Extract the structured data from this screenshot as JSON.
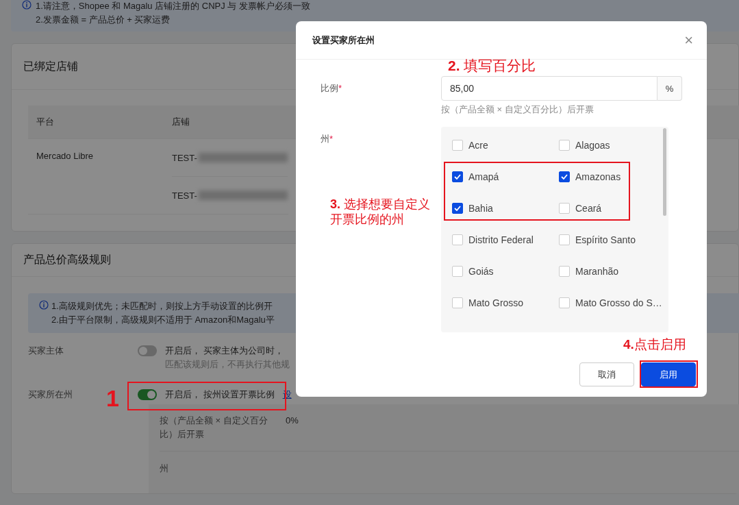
{
  "notice": {
    "lines": [
      "1.请注意，Shopee 和 Magalu 店铺注册的 CNPJ 与 发票帐户必须一致",
      "2.发票金额 = 产品总价 + 买家运费"
    ]
  },
  "bound_stores": {
    "title": "已绑定店铺",
    "columns": [
      "平台",
      "店铺"
    ],
    "rows": [
      {
        "platform": "Mercado Libre",
        "stores": [
          "TEST-",
          "TEST-"
        ]
      }
    ]
  },
  "advanced_rules": {
    "title": "产品总价高级规则",
    "notice_lines": [
      "1.高级规则优先；未匹配时，则按上方手动设置的比例开",
      "2.由于平台限制，高级规则不适用于 Amazon和Magalu平"
    ],
    "rules": [
      {
        "label": "买家主体",
        "on": false,
        "text": "开启后， 买家主体为公司时，",
        "hint": "匹配该规则后，不再执行其他规"
      },
      {
        "label": "买家所在州",
        "on": true,
        "text": "开启后， 按州设置开票比例",
        "link": "设"
      }
    ],
    "detail": {
      "formula": "按（产品全额 × 自定义百分比）后开票",
      "percent": "0%",
      "state_label": "州"
    }
  },
  "modal": {
    "title": "设置买家所在州",
    "close": "×",
    "ratio": {
      "label": "比例",
      "required_mark": "*",
      "value": "85,00",
      "suffix": "%",
      "hint": "按（产品全额 × 自定义百分比）后开票"
    },
    "states": {
      "label": "州",
      "required_mark": "*",
      "options": [
        {
          "label": "Acre",
          "checked": false
        },
        {
          "label": "Alagoas",
          "checked": false
        },
        {
          "label": "Amapá",
          "checked": true
        },
        {
          "label": "Amazonas",
          "checked": true
        },
        {
          "label": "Bahia",
          "checked": true
        },
        {
          "label": "Ceará",
          "checked": false
        },
        {
          "label": "Distrito Federal",
          "checked": false
        },
        {
          "label": "Espírito Santo",
          "checked": false
        },
        {
          "label": "Goiás",
          "checked": false
        },
        {
          "label": "Maranhão",
          "checked": false
        },
        {
          "label": "Mato Grosso",
          "checked": false
        },
        {
          "label": "Mato Grosso do S…",
          "checked": false
        }
      ]
    },
    "buttons": [
      {
        "label": "取消",
        "kind": "default"
      },
      {
        "label": "启用",
        "kind": "primary"
      }
    ]
  },
  "annotations": [
    {
      "text": "1"
    },
    {
      "text": "**2.** 填写百分比"
    },
    {
      "text": "**3.** 选择想要自定义开票比例的州"
    },
    {
      "text": "**4.**点击启用"
    }
  ]
}
